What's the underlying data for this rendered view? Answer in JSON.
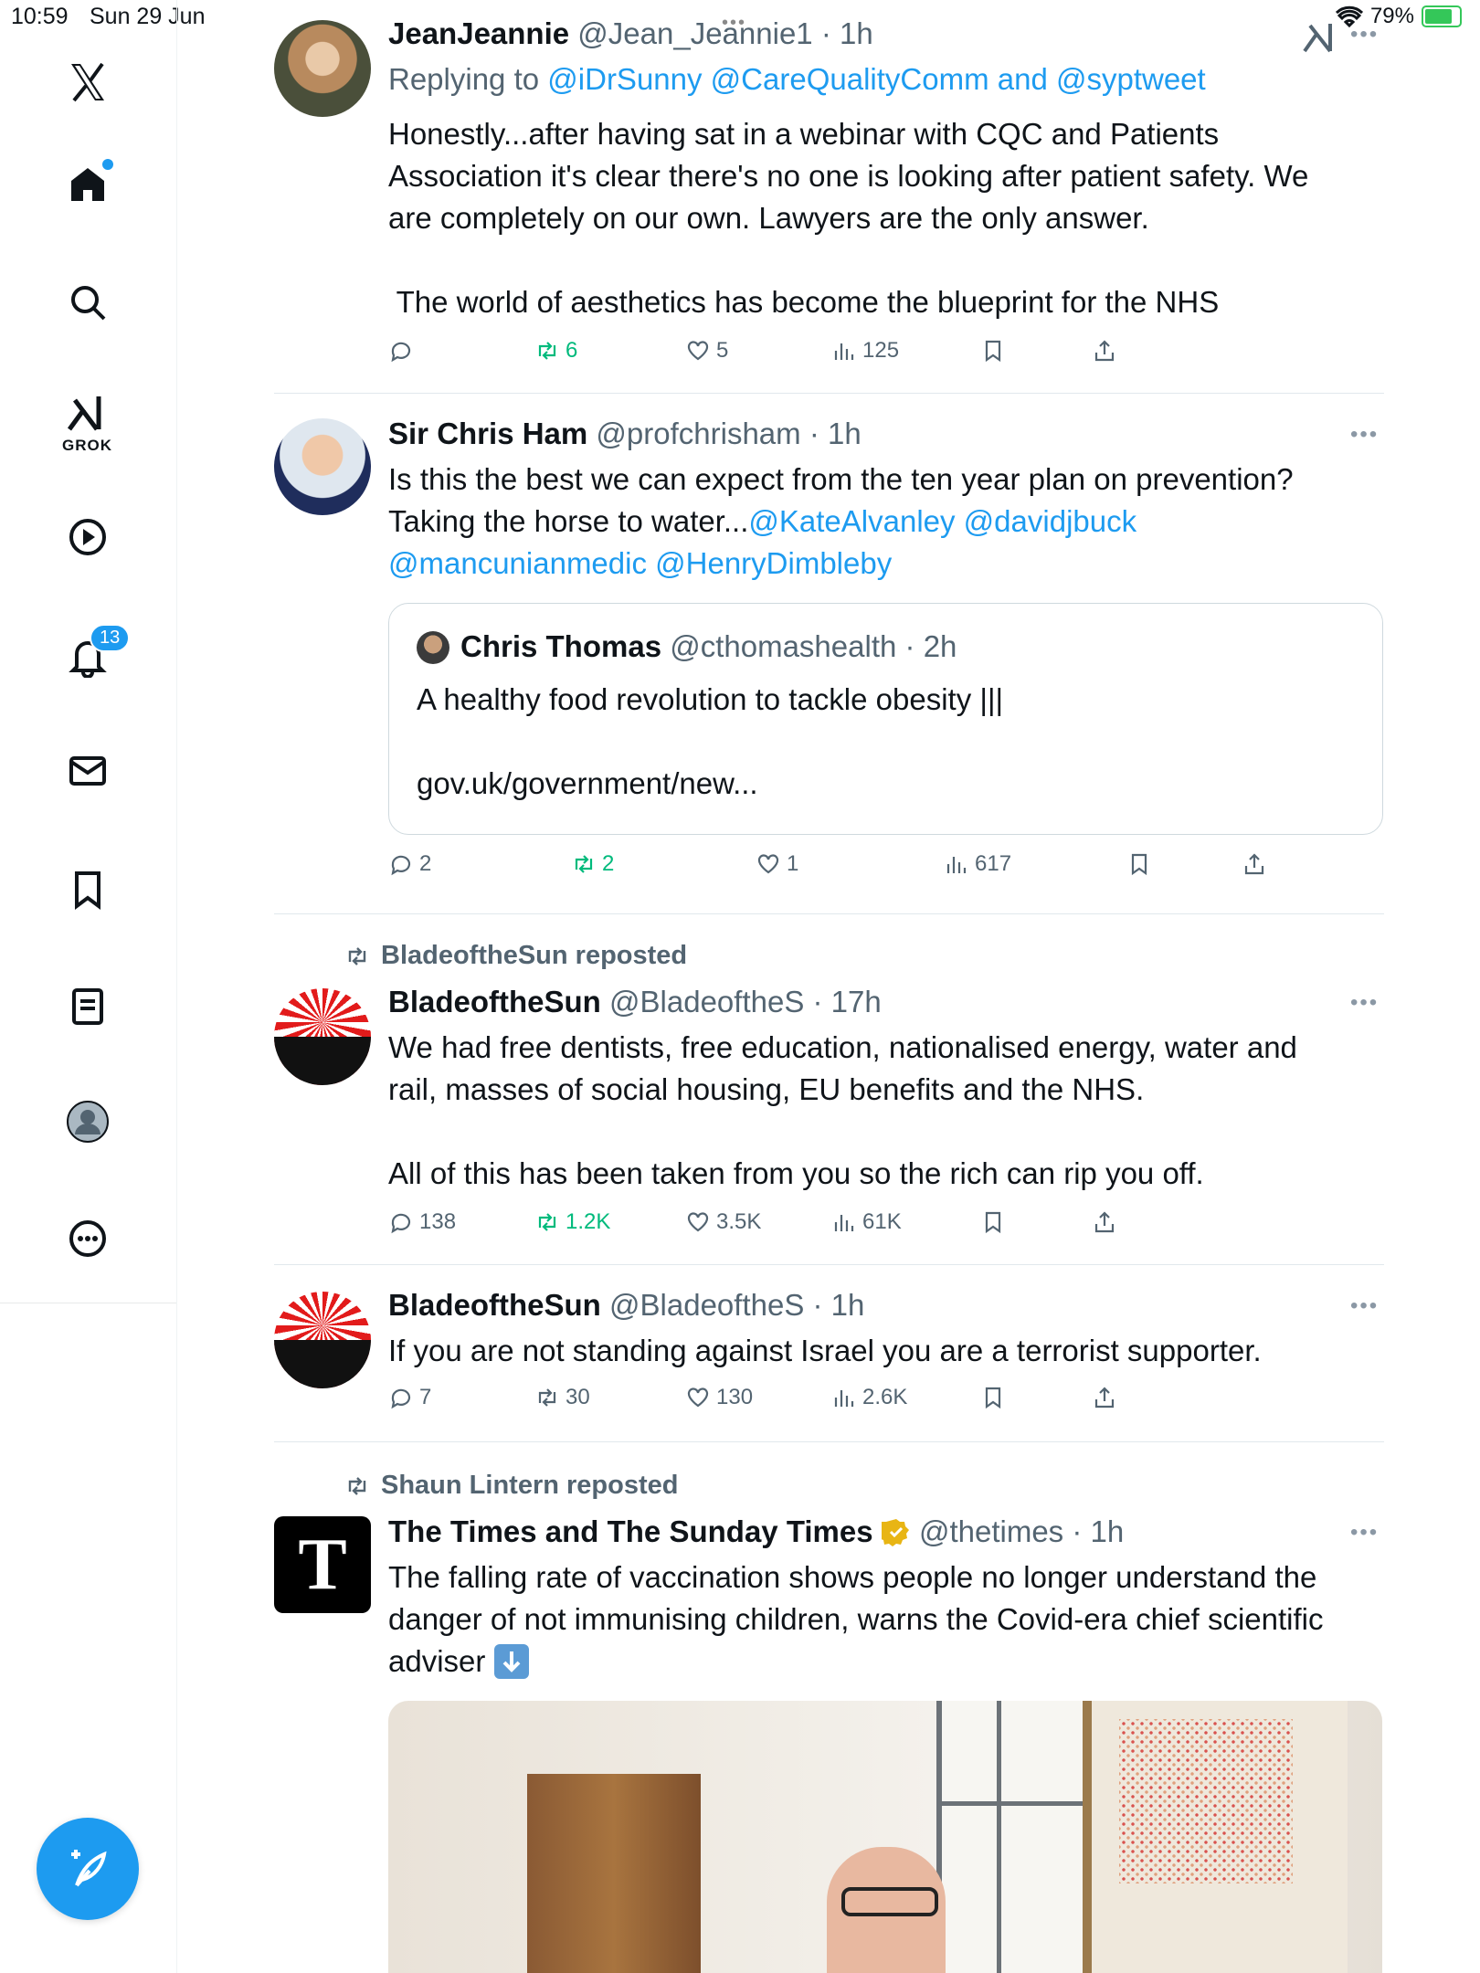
{
  "status_bar": {
    "time": "10:59",
    "date": "Sun 29 Jun",
    "battery": "79%"
  },
  "sidebar": {
    "items": [
      {
        "name": "home"
      },
      {
        "name": "explore"
      },
      {
        "name": "grok",
        "label": "GROK"
      },
      {
        "name": "videos"
      },
      {
        "name": "notifications",
        "badge": "13"
      },
      {
        "name": "messages"
      },
      {
        "name": "bookmarks"
      },
      {
        "name": "lists"
      },
      {
        "name": "profile"
      },
      {
        "name": "more"
      }
    ]
  },
  "tweets": [
    {
      "name": "JeanJeannie",
      "handle": "@Jean_Jeannie1",
      "time": "· 1h",
      "replying_prefix": "Replying to",
      "replying_links": "@iDrSunny @CareQualityComm and @syptweet",
      "lines": [
        "Honestly...after having sat in a webinar with CQC and Patients",
        "Association it's clear there's no one is looking after patient safety. We",
        "are completely on our own. Lawyers are the only answer.",
        " The world of aesthetics has become the blueprint for the NHS"
      ],
      "stats": {
        "replies": "",
        "reposts": "6",
        "likes": "5",
        "views": "125"
      }
    },
    {
      "name": "Sir Chris Ham",
      "handle": "@profchrisham",
      "time": "· 1h",
      "line1": "Is this the best we can expect from the ten year plan on prevention?",
      "line2_text": "Taking the horse to water...",
      "line2_links": "@KateAlvanley @davidjbuck",
      "line3_links": "@mancunianmedic @HenryDimbleby",
      "quote": {
        "name": "Chris Thomas",
        "handle": "@cthomashealth",
        "time": "· 2h",
        "line1": "A healthy food revolution to tackle obesity |||",
        "line2": "gov.uk/government/new..."
      },
      "stats": {
        "replies": "2",
        "reposts": "2",
        "likes": "1",
        "views": "617"
      }
    },
    {
      "repost_by": "BladeoftheSun reposted",
      "name": "BladeoftheSun",
      "handle": "@BladeoftheS",
      "time": "· 17h",
      "lines": [
        "We had free dentists, free education, nationalised energy, water and",
        "rail, masses of social housing, EU benefits and the NHS.",
        "All of this has been taken from you so the rich can rip you off."
      ],
      "stats": {
        "replies": "138",
        "reposts": "1.2K",
        "likes": "3.5K",
        "views": "61K"
      }
    },
    {
      "name": "BladeoftheSun",
      "handle": "@BladeoftheS",
      "time": "· 1h",
      "lines": [
        "If you are not standing against Israel you are a terrorist supporter."
      ],
      "stats": {
        "replies": "7",
        "reposts": "30",
        "likes": "130",
        "views": "2.6K"
      }
    },
    {
      "repost_by": "Shaun Lintern reposted",
      "name": "The Times and The Sunday Times",
      "handle": "@thetimes",
      "time": "· 1h",
      "lines": [
        "The falling rate of vaccination shows people no longer understand the",
        "danger of not immunising children, warns the Covid-era chief scientific",
        "adviser"
      ],
      "avatar_letter": "T"
    }
  ],
  "colors": {
    "accent": "#1d9bf0",
    "repost_green": "#00ba7c",
    "muted": "#536471"
  }
}
